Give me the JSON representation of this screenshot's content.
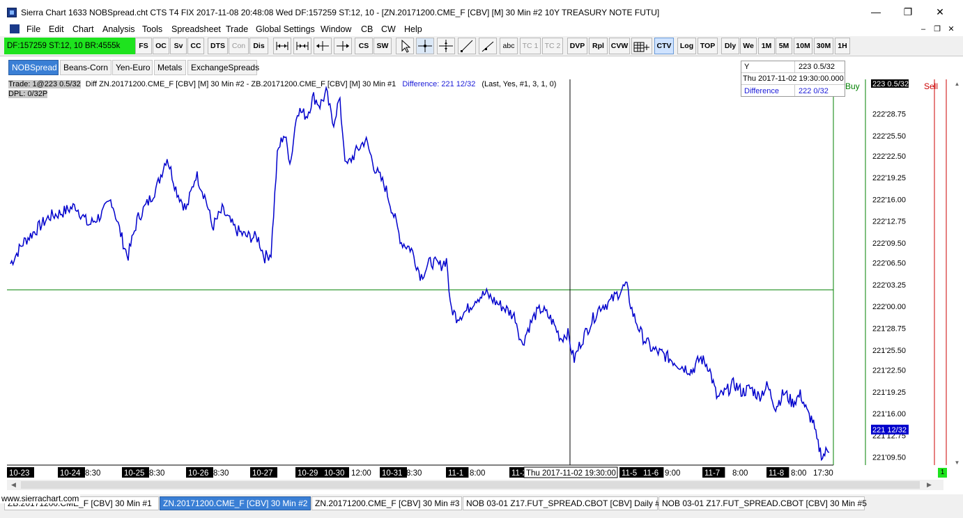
{
  "window": {
    "title": "Sierra Chart 1633 NOBSpread.cht  CTS T4 FIX 2017-11-08  20:48:08 Wed  DF:157259  ST:12, 10 - [ZN.20171200.CME_F [CBV] [M]  30 Min  #2  10Y TREASURY NOTE FUTU]",
    "minimize": "—",
    "maximize": "❐",
    "close": "✕"
  },
  "menu": {
    "items": [
      "File",
      "Edit",
      "Chart",
      "Analysis",
      "Tools",
      "Spreadsheet",
      "Trade",
      "Global Settings",
      "Window",
      "CB",
      "CW",
      "Help"
    ],
    "mdi_minimize": "–",
    "mdi_restore": "❐",
    "mdi_close": "✕"
  },
  "toolbar": {
    "status": "DF:157259  ST:12, 10  BR:4555k",
    "buttons": {
      "fs": "FS",
      "oc": "OC",
      "sv": "Sv",
      "cc": "CC",
      "dts": "DTS",
      "con": "Con",
      "dis": "Dis",
      "cs": "CS",
      "sw": "SW",
      "abc": "abc",
      "tc1": "TC 1",
      "tc2": "TC 2",
      "dvp": "DVP",
      "rpl": "Rpl",
      "cvw": "CVW",
      "ctv": "CTV",
      "log": "Log",
      "top": "TOP",
      "dly": "Dly",
      "we": "We",
      "m1": "1M",
      "m5": "5M",
      "m10": "10M",
      "m30": "30M",
      "h1": "1H"
    },
    "icons": {
      "zoom_in": "zoom-in-icon",
      "zoom_out": "zoom-out-icon",
      "scroll_left": "scroll-left-icon",
      "scroll_right": "scroll-right-icon",
      "pointer": "pointer-icon",
      "crosshair": "crosshair-icon",
      "crosshair_alt": "crosshair-alt-icon",
      "line": "line-tool-icon",
      "ray": "ray-tool-icon",
      "grid": "grid-icon"
    }
  },
  "chart_tabs": [
    {
      "label": "NOBSpread",
      "active": true
    },
    {
      "label": "Beans-Corn",
      "active": false
    },
    {
      "label": "Yen-Euro",
      "active": false
    },
    {
      "label": "Metals",
      "active": false
    },
    {
      "label": "ExchangeSpreads",
      "active": false
    }
  ],
  "tooltip": {
    "row1_label": "Y",
    "row1_value": "223 0.5/32",
    "row2_value": "Thu 2017-11-02  19:30:00.000",
    "row3_label": "Difference",
    "row3_value": "222 0/32"
  },
  "chart_header": {
    "trade": "Trade: 1@223 0.5/32",
    "study": "Diff ZN.20171200.CME_F [CBV] [M]  30 Min   #2 - ZB.20171200.CME_F [CBV] [M]  30 Min   #1",
    "difference": "Difference: 221 12/32",
    "params": "(Last, Yes, #1, 3, 1, 0)",
    "dpl": "DPL: 0/32P"
  },
  "side_labels": {
    "buy": "Buy",
    "sell": "Sell"
  },
  "price_labels": {
    "top": "223 0.5/32",
    "last": "221 12/32",
    "crosshair_time": "Thu 2017-11-02  19:30:00"
  },
  "colors": {
    "series": "#0000cc",
    "grid_h": "#008000",
    "status_bg": "#1ee31e",
    "tab_active": "#3a7fd5",
    "buy": "#008000",
    "sell": "#cc0000"
  },
  "chart_data": {
    "type": "line",
    "name": "Difference",
    "ylim_decimal": [
      221.26,
      223.06
    ],
    "y_ticks": [
      "222'28.75",
      "222'25.50",
      "222'22.50",
      "222'19.25",
      "222'16.00",
      "222'12.75",
      "222'09.50",
      "222'06.50",
      "222'03.25",
      "222'00.00",
      "221'28.75",
      "221'25.50",
      "221'22.50",
      "221'19.25",
      "221'16.00",
      "221'12.75",
      "221'09.50"
    ],
    "y_tick_values": [
      222.8984,
      222.7969,
      222.7031,
      222.6016,
      222.5,
      222.3984,
      222.2969,
      222.2031,
      222.1016,
      222.0,
      221.8984,
      221.7969,
      221.7031,
      221.6016,
      221.5,
      221.3984,
      221.2969
    ],
    "x_ticks": [
      {
        "label": "10-23",
        "day": true
      },
      {
        "label": "10-24",
        "day": true
      },
      {
        "label": "8:30",
        "day": false
      },
      {
        "label": "10-25",
        "day": true
      },
      {
        "label": "8:30",
        "day": false
      },
      {
        "label": "10-26",
        "day": true
      },
      {
        "label": "8:30",
        "day": false
      },
      {
        "label": "10-27",
        "day": true
      },
      {
        "label": "10-29",
        "day": true
      },
      {
        "label": "10-30",
        "day": true
      },
      {
        "label": "12:00",
        "day": false
      },
      {
        "label": "10-31",
        "day": true
      },
      {
        "label": "8:30",
        "day": false
      },
      {
        "label": "11-1",
        "day": true
      },
      {
        "label": "8:00",
        "day": false
      },
      {
        "label": "11-2",
        "day": true
      },
      {
        "label": "11-5",
        "day": true
      },
      {
        "label": "11-6",
        "day": true
      },
      {
        "label": "9:00",
        "day": false
      },
      {
        "label": "11-7",
        "day": true
      },
      {
        "label": "8:00",
        "day": false
      },
      {
        "label": "11-8",
        "day": true
      },
      {
        "label": "8:00",
        "day": false
      },
      {
        "label": "17:30",
        "day": false
      }
    ],
    "anchors": [
      [
        0,
        222.2
      ],
      [
        0.02,
        222.3
      ],
      [
        0.04,
        222.36
      ],
      [
        0.06,
        222.42
      ],
      [
        0.08,
        222.44
      ],
      [
        0.1,
        222.47
      ],
      [
        0.12,
        222.38
      ],
      [
        0.14,
        222.43
      ],
      [
        0.155,
        222.5
      ],
      [
        0.17,
        222.33
      ],
      [
        0.18,
        222.23
      ],
      [
        0.195,
        222.41
      ],
      [
        0.21,
        222.48
      ],
      [
        0.225,
        222.56
      ],
      [
        0.24,
        222.7
      ],
      [
        0.255,
        222.54
      ],
      [
        0.27,
        222.45
      ],
      [
        0.285,
        222.62
      ],
      [
        0.3,
        222.5
      ],
      [
        0.31,
        222.37
      ],
      [
        0.325,
        222.45
      ],
      [
        0.345,
        222.36
      ],
      [
        0.36,
        222.33
      ],
      [
        0.38,
        222.32
      ],
      [
        0.39,
        222.23
      ],
      [
        0.4,
        222.25
      ],
      [
        0.41,
        222.72
      ],
      [
        0.42,
        222.81
      ],
      [
        0.43,
        222.67
      ],
      [
        0.44,
        222.92
      ],
      [
        0.455,
        222.89
      ],
      [
        0.465,
        222.98
      ],
      [
        0.475,
        222.94
      ],
      [
        0.485,
        223.0
      ],
      [
        0.495,
        222.85
      ],
      [
        0.505,
        222.97
      ],
      [
        0.515,
        222.65
      ],
      [
        0.53,
        222.72
      ],
      [
        0.545,
        222.78
      ],
      [
        0.56,
        222.64
      ],
      [
        0.575,
        222.56
      ],
      [
        0.59,
        222.41
      ],
      [
        0.6,
        222.3
      ],
      [
        0.615,
        222.27
      ],
      [
        0.63,
        222.14
      ],
      [
        0.645,
        222.21
      ],
      [
        0.66,
        222.19
      ],
      [
        0.67,
        222.22
      ],
      [
        0.675,
        222.0
      ],
      [
        0.685,
        221.95
      ],
      [
        0.7,
        221.98
      ],
      [
        0.715,
        222.04
      ],
      [
        0.73,
        222.06
      ],
      [
        0.745,
        222.02
      ],
      [
        0.76,
        221.99
      ],
      [
        0.775,
        221.95
      ],
      [
        0.785,
        221.82
      ],
      [
        0.795,
        221.9
      ],
      [
        0.805,
        221.96
      ],
      [
        0.815,
        221.99
      ],
      [
        0.83,
        221.94
      ],
      [
        0.845,
        221.85
      ],
      [
        0.855,
        221.88
      ],
      [
        0.865,
        221.75
      ],
      [
        0.875,
        221.83
      ],
      [
        0.89,
        221.92
      ],
      [
        0.905,
        222.0
      ],
      [
        0.92,
        222.02
      ],
      [
        0.935,
        222.07
      ],
      [
        0.945,
        222.1
      ],
      [
        0.955,
        221.97
      ],
      [
        0.97,
        221.86
      ],
      [
        0.985,
        221.8
      ],
      [
        1.0,
        221.78
      ]
    ],
    "anchors2": [
      [
        0,
        221.78
      ],
      [
        0.06,
        221.75
      ],
      [
        0.12,
        221.72
      ],
      [
        0.18,
        221.7
      ],
      [
        0.23,
        221.76
      ],
      [
        0.28,
        221.72
      ],
      [
        0.33,
        221.57
      ],
      [
        0.38,
        221.6
      ],
      [
        0.43,
        221.64
      ],
      [
        0.48,
        221.6
      ],
      [
        0.53,
        221.62
      ],
      [
        0.58,
        221.58
      ],
      [
        0.63,
        221.63
      ],
      [
        0.68,
        221.53
      ],
      [
        0.73,
        221.6
      ],
      [
        0.78,
        221.55
      ],
      [
        0.83,
        221.59
      ],
      [
        0.87,
        221.5
      ],
      [
        0.9,
        221.47
      ],
      [
        0.93,
        221.36
      ],
      [
        0.96,
        221.3
      ],
      [
        0.98,
        221.32
      ],
      [
        1.0,
        221.34
      ]
    ],
    "h_line_value": 222.0781
  }
}
